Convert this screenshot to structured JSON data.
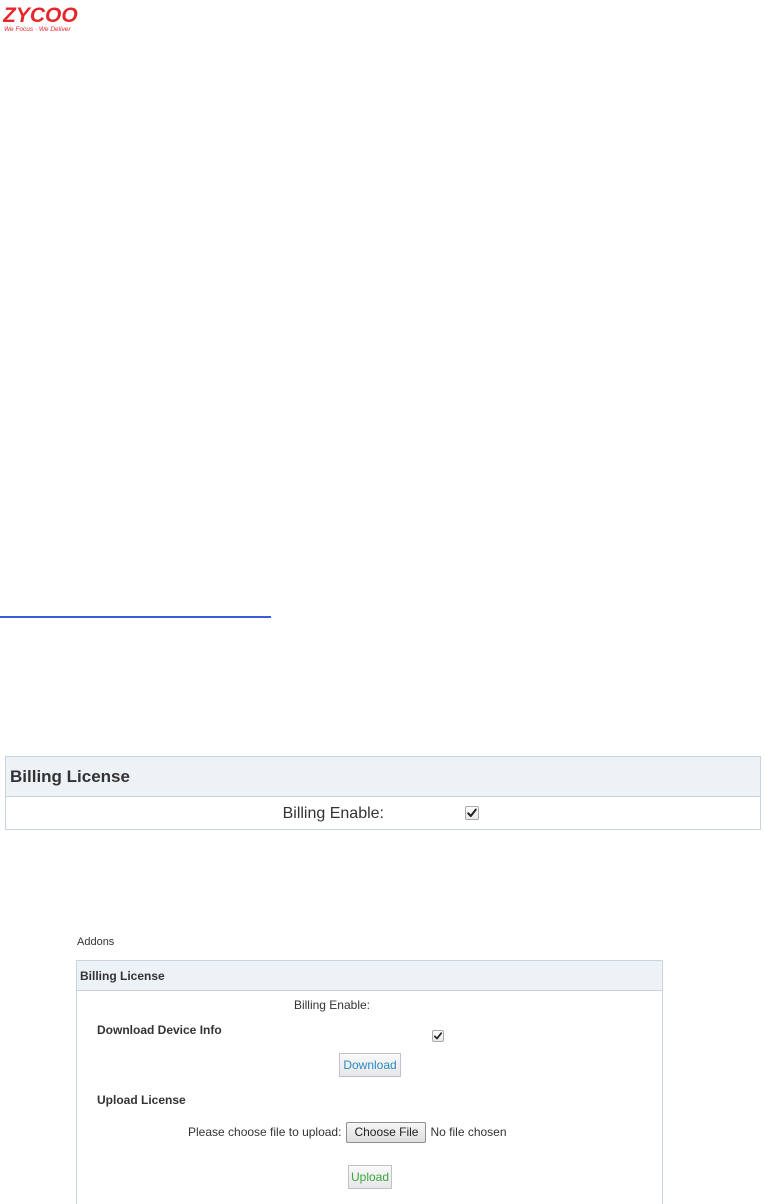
{
  "brand": {
    "logo_text": "ZYCOO",
    "tagline": "We Focus · We Deliver",
    "logo_color": "#e5262a"
  },
  "billing_panel": {
    "title": "Billing License",
    "billing_enable_label": "Billing Enable:",
    "billing_enabled": true
  },
  "addons_panel": {
    "caption": "Addons",
    "title": "Billing License",
    "billing_enable_label": "Billing Enable:",
    "billing_enabled": true,
    "download_section_title": "Download Device Info",
    "download_button_label": "Download",
    "upload_section_title": "Upload License",
    "upload_prompt": "Please choose file to upload:",
    "choose_file_label": "Choose File",
    "no_file_text": "No file chosen",
    "upload_button_label": "Upload"
  },
  "colors": {
    "panel_header_bg": "#edf2f7",
    "panel_border": "#c9d3dc",
    "download_text": "#2a8ac8",
    "upload_text": "#3aa640",
    "link_underline": "#3b5bd8"
  }
}
